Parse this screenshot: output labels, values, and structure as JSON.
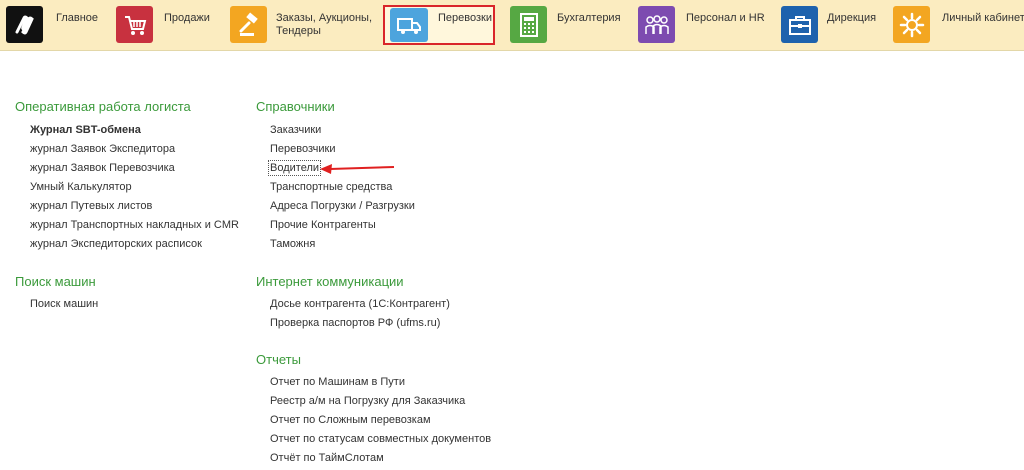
{
  "nav": {
    "main": "Главное",
    "sales": "Продажи",
    "orders_line1": "Заказы,  Аукционы,",
    "orders_line2": "Тендеры",
    "transport": "Перевозки",
    "accounting": "Бухгалтерия",
    "hr": "Персонал и HR",
    "direction": "Дирекция",
    "cabinet": "Личный кабинет",
    "colors": {
      "main_icon": "#111111",
      "sales_icon": "#c8313f",
      "orders_icon": "#f3a621",
      "transport_icon": "#4da4dd",
      "accounting_icon": "#56a843",
      "hr_icon": "#7d4bb0",
      "direction_icon": "#1e62ad",
      "cabinet_icon": "#f3a621",
      "active_border": "#d9252a"
    },
    "icons": {
      "main": "logo-icon",
      "sales": "cart-icon",
      "orders": "gavel-icon",
      "transport": "truck-icon",
      "accounting": "calculator-icon",
      "hr": "people-icon",
      "direction": "briefcase-icon",
      "cabinet": "gear-icon"
    }
  },
  "left": {
    "ops_title": "Оперативная работа логиста",
    "ops_items": [
      "Журнал SBT-обмена",
      "журнал Заявок Экспедитора",
      "журнал Заявок Перевозчика",
      "Умный Калькулятор",
      "журнал Путевых листов",
      "журнал Транспортных накладных и CMR",
      "журнал Экспедиторских расписок"
    ],
    "search_title": "Поиск машин",
    "search_items": [
      "Поиск машин"
    ]
  },
  "right": {
    "ref_title": "Справочники",
    "ref_items": [
      "Заказчики",
      "Перевозчики",
      "Водители",
      "Транспортные средства",
      "Адреса Погрузки / Разгрузки",
      "Прочие Контрагенты",
      "Таможня"
    ],
    "inet_title": "Интернет коммуникации",
    "inet_items": [
      "Досье контрагента (1С:Контрагент)",
      "Проверка паспортов РФ (ufms.ru)"
    ],
    "reports_title": "Отчеты",
    "reports_items": [
      "Отчет по Машинам в Пути",
      "Реестр а/м на Погрузку для Заказчика",
      "Отчет по Сложным перевозкам",
      "Отчет по статусам совместных документов",
      "Отчёт по ТаймСлотам"
    ]
  },
  "annotation": {
    "arrow_color": "#e02020"
  }
}
